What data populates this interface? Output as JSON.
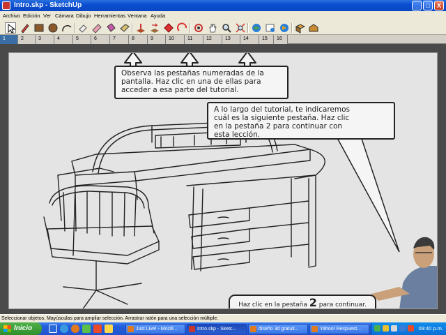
{
  "window": {
    "title": "Intro.skp - SketchUp",
    "buttons": [
      "_",
      "□",
      "X"
    ]
  },
  "menu": [
    "Archivo",
    "Edición",
    "Ver",
    "Cámara",
    "Dibujo",
    "Herramientas",
    "Ventana",
    "Ayuda"
  ],
  "toolbar": {
    "tools": [
      "select-icon",
      "pencil-icon",
      "rectangle-icon",
      "circle-icon",
      "arc-icon",
      "eraser-icon",
      "paint-bucket-icon",
      "push-pull-icon",
      "follow-me-icon",
      "move-icon",
      "rotate-icon",
      "offset-icon",
      "orbit-icon",
      "pan-icon",
      "zoom-icon",
      "zoom-extents-icon",
      "get-models-icon",
      "share-model-icon",
      "google-earth-icon",
      "components-icon",
      "warehouse-icon"
    ]
  },
  "tabs": [
    "1",
    "2",
    "3",
    "4",
    "5",
    "6",
    "7",
    "8",
    "9",
    "10",
    "11",
    "12",
    "13",
    "14",
    "15",
    "16"
  ],
  "tutorial": {
    "bubble1": [
      "Observa las pestañas numeradas de la",
      "pantalla. Haz clic en una de ellas para",
      "acceder a esa parte del tutorial."
    ],
    "bubble2": [
      "A lo largo del tutorial, te indicaremos",
      "cuál es la siguiente pestaña. Haz clic",
      "en la pestaña 2 para continuar con",
      "esta lección."
    ],
    "cta_before": "Haz clic en la pestaña",
    "cta_number": "2",
    "cta_after": "para continuar."
  },
  "statusbar": {
    "text": "Seleccionar objetos. Mayúsculas para ampliar selección. Arrastrar ratón para una selección múltiple."
  },
  "taskbar": {
    "start_label": "Inicio",
    "tasks": [
      "Just Live! - Mozill...",
      "Intro.skp - Sketc...",
      "diseño 3d gratuit...",
      "Yahoo! Respuest..."
    ],
    "clock": "09:40 p.m."
  },
  "colors": {
    "title_bar": "#0a4fd0",
    "active_tab": "#3a6ea5",
    "canvas_bg": "#e4e4e4",
    "viewport_frame": "#4a4a4a",
    "start_button": "#2f8f2a"
  }
}
